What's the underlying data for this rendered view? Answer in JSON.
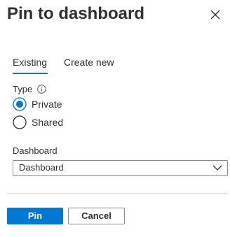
{
  "panel": {
    "title": "Pin to dashboard",
    "close_icon": "close-icon"
  },
  "tabs": [
    {
      "label": "Existing",
      "selected": true
    },
    {
      "label": "Create new",
      "selected": false
    }
  ],
  "type_field": {
    "label": "Type",
    "info_icon": "info-icon",
    "options": [
      {
        "label": "Private",
        "selected": true
      },
      {
        "label": "Shared",
        "selected": false
      }
    ]
  },
  "dashboard_field": {
    "label": "Dashboard",
    "selected_value": "Dashboard",
    "chevron_icon": "chevron-down-icon"
  },
  "actions": {
    "pin_label": "Pin",
    "cancel_label": "Cancel"
  },
  "colors": {
    "accent": "#0078d4",
    "text": "#323130",
    "border": "#8a8886",
    "divider": "#e1dfdd"
  }
}
